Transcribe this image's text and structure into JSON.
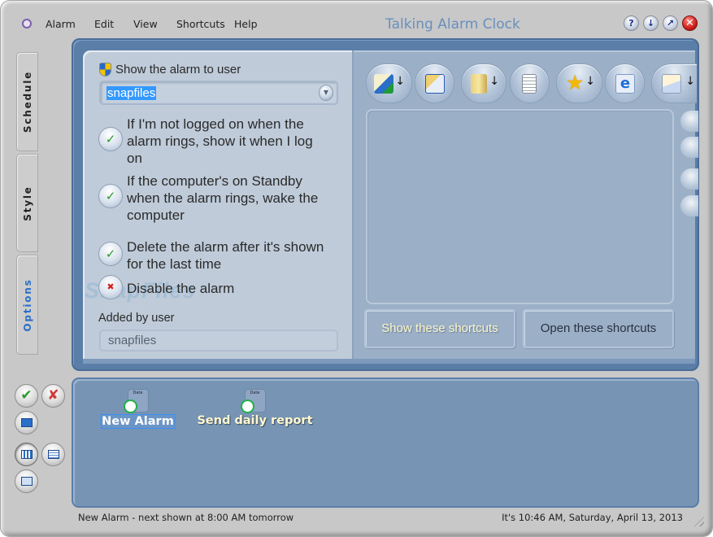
{
  "window": {
    "title": "Talking Alarm Clock",
    "app_icon": "alarm-clock-icon"
  },
  "menu": {
    "items": [
      {
        "label": "Alarm"
      },
      {
        "label": "Edit"
      },
      {
        "label": "View"
      },
      {
        "label": "Shortcuts"
      },
      {
        "label": "Help"
      }
    ]
  },
  "window_buttons": {
    "help": {
      "glyph": "?",
      "icon": "help-icon"
    },
    "minimize": {
      "glyph": "↓",
      "icon": "minimize-down-arrow-icon"
    },
    "restore": {
      "glyph": "↗",
      "icon": "restore-arrow-icon"
    },
    "close": {
      "glyph": "✕",
      "icon": "close-icon"
    }
  },
  "side_tabs": [
    {
      "label": "Schedule",
      "active": false
    },
    {
      "label": "Style",
      "active": false
    },
    {
      "label": "Options",
      "active": true
    }
  ],
  "options": {
    "show_to_user_label": "Show the alarm to user",
    "show_to_user_value": "snapfiles",
    "checkboxes": [
      {
        "label": "If I'm not logged on when the alarm rings, show it when I log on",
        "lines": [
          "If I'm not logged on when the",
          "alarm rings, show it when I log",
          "on"
        ],
        "checked": true,
        "glyph": "✓"
      },
      {
        "label": "If the computer's on Standby when the alarm rings, wake the computer",
        "lines": [
          "If the computer's on Standby",
          "when the alarm rings, wake the",
          "computer"
        ],
        "checked": true,
        "glyph": "✓"
      },
      {
        "label": "Delete the alarm after it's shown for the last time",
        "lines": [
          "Delete the alarm after it's shown",
          "for the last time"
        ],
        "checked": true,
        "glyph": "✓"
      },
      {
        "label": "Disable the alarm",
        "lines": [
          "Disable the alarm"
        ],
        "checked": false,
        "glyph": "✖"
      }
    ],
    "added_by_label": "Added by user",
    "added_by_value": "snapfiles",
    "watermark": "SnapFiles"
  },
  "shortcuts": {
    "toolbar": [
      {
        "icon": "control-panel-icon",
        "has_dropdown": true
      },
      {
        "icon": "folder-programs-icon",
        "has_dropdown": false
      },
      {
        "icon": "folder-open-icon",
        "has_dropdown": true
      },
      {
        "icon": "document-icon",
        "has_dropdown": false
      },
      {
        "icon": "favorites-star-icon",
        "has_dropdown": true
      },
      {
        "icon": "internet-explorer-icon",
        "has_dropdown": false
      },
      {
        "icon": "email-envelope-icon",
        "has_dropdown": true
      }
    ],
    "dropdown_glyph": "↓",
    "list_items": [],
    "side_tools": [
      "remove-icon",
      "computer-icon",
      "edit-icon",
      "new-document-icon"
    ],
    "show_button": "Show these shortcuts",
    "open_button": "Open these shortcuts"
  },
  "left_actions": {
    "ok": {
      "glyph": "✔",
      "icon": "check-icon",
      "color": "#2a9a2a"
    },
    "cancel": {
      "glyph": "✘",
      "icon": "cancel-x-icon",
      "color": "#d03a3a"
    },
    "rename": {
      "icon": "rename-icon"
    },
    "view_icons": {
      "icon": "large-icons-view-icon"
    },
    "view_list": {
      "icon": "details-view-icon"
    },
    "alarm_view": {
      "icon": "alarm-view-icon"
    }
  },
  "alarms": [
    {
      "name": "New Alarm",
      "selected": true,
      "icon_text": "Date"
    },
    {
      "name": "Send daily report",
      "selected": false,
      "icon_text": "Date"
    }
  ],
  "status": {
    "left": "New Alarm - next shown at 8:00 AM tomorrow",
    "right": "It's 10:46 AM, Saturday, April 13, 2013"
  },
  "colors": {
    "accent_blue": "#2a6fc8",
    "frame_blue": "#5a7ea8",
    "selection": "#3399ff",
    "title_text": "#6a8fbc"
  }
}
